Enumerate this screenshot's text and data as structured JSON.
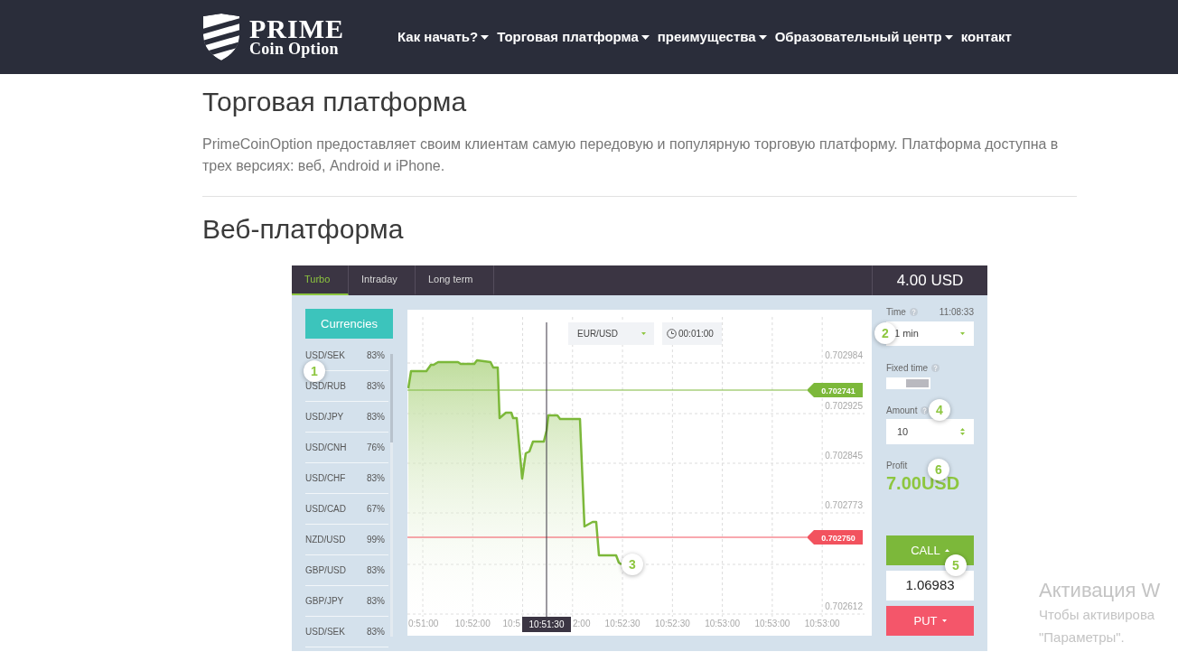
{
  "header": {
    "logo": {
      "title": "PRIME",
      "subtitle": "Coin Option"
    },
    "nav": [
      {
        "label": "Как начать?",
        "dropdown": true
      },
      {
        "label": "Торговая платформа",
        "dropdown": true
      },
      {
        "label": "преимущества",
        "dropdown": true
      },
      {
        "label": "Образовательный центр",
        "dropdown": true
      },
      {
        "label": "контакт",
        "dropdown": false
      }
    ]
  },
  "page": {
    "title": "Торговая платформа",
    "intro": "PrimeCoinOption предоставляет своим клиентам самую передовую и популярную торговую платформу. Платформа доступна в трех версиях: веб, Android и iPhone.",
    "section_title": "Веб-платформа"
  },
  "platform": {
    "tabs": [
      {
        "label": "Turbo",
        "selected": true
      },
      {
        "label": "Intraday",
        "selected": false
      },
      {
        "label": "Long term",
        "selected": false
      }
    ],
    "balance": "4.00 USD",
    "currencies": {
      "button": "Currencies",
      "callout": "1",
      "items": [
        {
          "pair": "USD/SEK",
          "payout": "83%"
        },
        {
          "pair": "USD/RUB",
          "payout": "83%"
        },
        {
          "pair": "USD/JPY",
          "payout": "83%"
        },
        {
          "pair": "USD/CNH",
          "payout": "76%"
        },
        {
          "pair": "USD/CHF",
          "payout": "83%"
        },
        {
          "pair": "USD/CAD",
          "payout": "67%"
        },
        {
          "pair": "NZD/USD",
          "payout": "99%"
        },
        {
          "pair": "GBP/USD",
          "payout": "83%"
        },
        {
          "pair": "GBP/JPY",
          "payout": "83%"
        },
        {
          "pair": "USD/SEK",
          "payout": "83%"
        }
      ]
    },
    "chart": {
      "asset": "EUR/USD",
      "timer": "00:01:00",
      "y_axis_labels": [
        "0.702984",
        "0.702925",
        "0.702845",
        "0.702773",
        "0.702612"
      ],
      "x_axis_labels": [
        "0:51:00",
        "10:52:00",
        "10:5",
        "2:00",
        "10:52:30",
        "10:52:30",
        "10:53:00",
        "10:53:00",
        "10:53:00"
      ],
      "price_tags": [
        {
          "text": "0.702741",
          "color": "#7cb83a"
        },
        {
          "text": "0.702750",
          "color": "#f2525e"
        }
      ],
      "cursor_time": "10:51:30",
      "callout": "3"
    },
    "order": {
      "time_label": "Time",
      "clock": "11:08:33",
      "duration": "1 min",
      "duration_callout": "2",
      "fixed_time_label": "Fixed time",
      "fixed_time_on": true,
      "amount_label": "Amount",
      "amount": "10",
      "amount_callout": "4",
      "profit_label": "Profit",
      "profit": "7.00USD",
      "profit_callout": "6",
      "call": "CALL",
      "call_callout": "5",
      "price": "1.06983",
      "put": "PUT"
    }
  },
  "os_notice": {
    "title": "Активация W",
    "lines": [
      "Чтобы активирова",
      "\"Параметры\"."
    ]
  }
}
